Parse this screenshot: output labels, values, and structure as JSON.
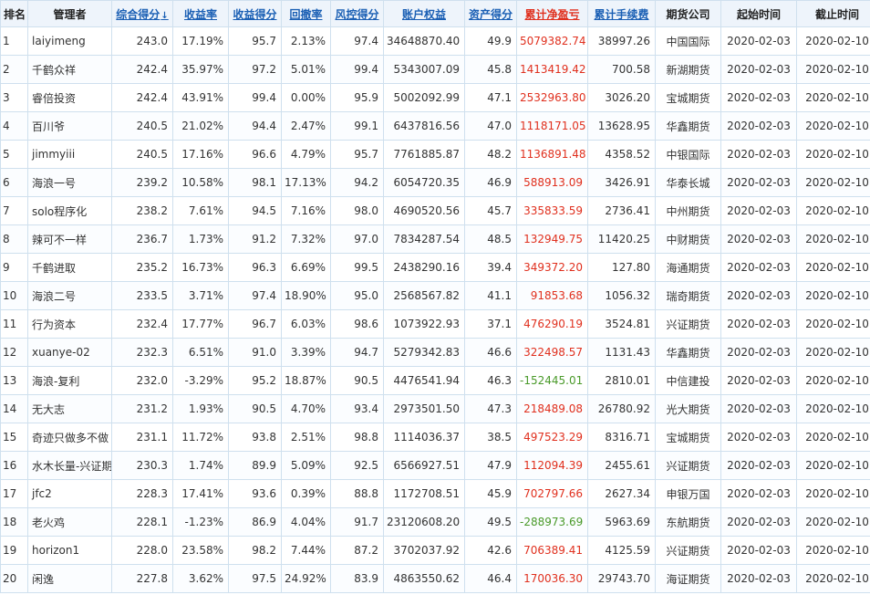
{
  "headers": [
    "排名",
    "管理者",
    "综合得分",
    "收益率",
    "收益得分",
    "回撤率",
    "风控得分",
    "账户权益",
    "资产得分",
    "累计净盈亏",
    "累计手续费",
    "期货公司",
    "起始时间",
    "截止时间"
  ],
  "sort_indicator": "↓",
  "colors": {
    "positive": "#e0301e",
    "negative": "#4a9a2a",
    "link": "#1a5fb4"
  },
  "rows": [
    {
      "rank": "1",
      "name": "laiyimeng",
      "score": "243.0",
      "ret": "17.19%",
      "ret_score": "95.7",
      "dd": "2.13%",
      "risk": "97.4",
      "equity": "34648870.40",
      "asset": "49.9",
      "pnl": "5079382.74",
      "fee": "38997.26",
      "company": "中国国际",
      "start": "2020-02-03",
      "end": "2020-02-10"
    },
    {
      "rank": "2",
      "name": "千鹤众祥",
      "score": "242.4",
      "ret": "35.97%",
      "ret_score": "97.2",
      "dd": "5.01%",
      "risk": "99.4",
      "equity": "5343007.09",
      "asset": "45.8",
      "pnl": "1413419.42",
      "fee": "700.58",
      "company": "新湖期货",
      "start": "2020-02-03",
      "end": "2020-02-10"
    },
    {
      "rank": "3",
      "name": "睿倍投资",
      "score": "242.4",
      "ret": "43.91%",
      "ret_score": "99.4",
      "dd": "0.00%",
      "risk": "95.9",
      "equity": "5002092.99",
      "asset": "47.1",
      "pnl": "2532963.80",
      "fee": "3026.20",
      "company": "宝城期货",
      "start": "2020-02-03",
      "end": "2020-02-10"
    },
    {
      "rank": "4",
      "name": "百川爷",
      "score": "240.5",
      "ret": "21.02%",
      "ret_score": "94.4",
      "dd": "2.47%",
      "risk": "99.1",
      "equity": "6437816.56",
      "asset": "47.0",
      "pnl": "1118171.05",
      "fee": "13628.95",
      "company": "华鑫期货",
      "start": "2020-02-03",
      "end": "2020-02-10"
    },
    {
      "rank": "5",
      "name": "jimmyiii",
      "score": "240.5",
      "ret": "17.16%",
      "ret_score": "96.6",
      "dd": "4.79%",
      "risk": "95.7",
      "equity": "7761885.87",
      "asset": "48.2",
      "pnl": "1136891.48",
      "fee": "4358.52",
      "company": "中银国际",
      "start": "2020-02-03",
      "end": "2020-02-10"
    },
    {
      "rank": "6",
      "name": "海浪一号",
      "score": "239.2",
      "ret": "10.58%",
      "ret_score": "98.1",
      "dd": "17.13%",
      "risk": "94.2",
      "equity": "6054720.35",
      "asset": "46.9",
      "pnl": "588913.09",
      "fee": "3426.91",
      "company": "华泰长城",
      "start": "2020-02-03",
      "end": "2020-02-10"
    },
    {
      "rank": "7",
      "name": "solo程序化",
      "score": "238.2",
      "ret": "7.61%",
      "ret_score": "94.5",
      "dd": "7.16%",
      "risk": "98.0",
      "equity": "4690520.56",
      "asset": "45.7",
      "pnl": "335833.59",
      "fee": "2736.41",
      "company": "中州期货",
      "start": "2020-02-03",
      "end": "2020-02-10"
    },
    {
      "rank": "8",
      "name": "辣可不一样",
      "score": "236.7",
      "ret": "1.73%",
      "ret_score": "91.2",
      "dd": "7.32%",
      "risk": "97.0",
      "equity": "7834287.54",
      "asset": "48.5",
      "pnl": "132949.75",
      "fee": "11420.25",
      "company": "中财期货",
      "start": "2020-02-03",
      "end": "2020-02-10"
    },
    {
      "rank": "9",
      "name": "千鹤进取",
      "score": "235.2",
      "ret": "16.73%",
      "ret_score": "96.3",
      "dd": "6.69%",
      "risk": "99.5",
      "equity": "2438290.16",
      "asset": "39.4",
      "pnl": "349372.20",
      "fee": "127.80",
      "company": "海通期货",
      "start": "2020-02-03",
      "end": "2020-02-10"
    },
    {
      "rank": "10",
      "name": "海浪二号",
      "score": "233.5",
      "ret": "3.71%",
      "ret_score": "97.4",
      "dd": "18.90%",
      "risk": "95.0",
      "equity": "2568567.82",
      "asset": "41.1",
      "pnl": "91853.68",
      "fee": "1056.32",
      "company": "瑞奇期货",
      "start": "2020-02-03",
      "end": "2020-02-10"
    },
    {
      "rank": "11",
      "name": "行为资本",
      "score": "232.4",
      "ret": "17.77%",
      "ret_score": "96.7",
      "dd": "6.03%",
      "risk": "98.6",
      "equity": "1073922.93",
      "asset": "37.1",
      "pnl": "476290.19",
      "fee": "3524.81",
      "company": "兴证期货",
      "start": "2020-02-03",
      "end": "2020-02-10"
    },
    {
      "rank": "12",
      "name": "xuanye-02",
      "score": "232.3",
      "ret": "6.51%",
      "ret_score": "91.0",
      "dd": "3.39%",
      "risk": "94.7",
      "equity": "5279342.83",
      "asset": "46.6",
      "pnl": "322498.57",
      "fee": "1131.43",
      "company": "华鑫期货",
      "start": "2020-02-03",
      "end": "2020-02-10"
    },
    {
      "rank": "13",
      "name": "海浪-复利",
      "score": "232.0",
      "ret": "-3.29%",
      "ret_score": "95.2",
      "dd": "18.87%",
      "risk": "90.5",
      "equity": "4476541.94",
      "asset": "46.3",
      "pnl": "-152445.01",
      "fee": "2810.01",
      "company": "中信建投",
      "start": "2020-02-03",
      "end": "2020-02-10"
    },
    {
      "rank": "14",
      "name": "无大志",
      "score": "231.2",
      "ret": "1.93%",
      "ret_score": "90.5",
      "dd": "4.70%",
      "risk": "93.4",
      "equity": "2973501.50",
      "asset": "47.3",
      "pnl": "218489.08",
      "fee": "26780.92",
      "company": "光大期货",
      "start": "2020-02-03",
      "end": "2020-02-10"
    },
    {
      "rank": "15",
      "name": "奇迹只做多不做",
      "score": "231.1",
      "ret": "11.72%",
      "ret_score": "93.8",
      "dd": "2.51%",
      "risk": "98.8",
      "equity": "1114036.37",
      "asset": "38.5",
      "pnl": "497523.29",
      "fee": "8316.71",
      "company": "宝城期货",
      "start": "2020-02-03",
      "end": "2020-02-10"
    },
    {
      "rank": "16",
      "name": "水木长量-兴证期",
      "score": "230.3",
      "ret": "1.74%",
      "ret_score": "89.9",
      "dd": "5.09%",
      "risk": "92.5",
      "equity": "6566927.51",
      "asset": "47.9",
      "pnl": "112094.39",
      "fee": "2455.61",
      "company": "兴证期货",
      "start": "2020-02-03",
      "end": "2020-02-10"
    },
    {
      "rank": "17",
      "name": "jfc2",
      "score": "228.3",
      "ret": "17.41%",
      "ret_score": "93.6",
      "dd": "0.39%",
      "risk": "88.8",
      "equity": "1172708.51",
      "asset": "45.9",
      "pnl": "702797.66",
      "fee": "2627.34",
      "company": "申银万国",
      "start": "2020-02-03",
      "end": "2020-02-10"
    },
    {
      "rank": "18",
      "name": "老火鸡",
      "score": "228.1",
      "ret": "-1.23%",
      "ret_score": "86.9",
      "dd": "4.04%",
      "risk": "91.7",
      "equity": "23120608.20",
      "asset": "49.5",
      "pnl": "-288973.69",
      "fee": "5963.69",
      "company": "东航期货",
      "start": "2020-02-03",
      "end": "2020-02-10"
    },
    {
      "rank": "19",
      "name": "horizon1",
      "score": "228.0",
      "ret": "23.58%",
      "ret_score": "98.2",
      "dd": "7.44%",
      "risk": "87.2",
      "equity": "3702037.92",
      "asset": "42.6",
      "pnl": "706389.41",
      "fee": "4125.59",
      "company": "兴证期货",
      "start": "2020-02-03",
      "end": "2020-02-10"
    },
    {
      "rank": "20",
      "name": "闲逸",
      "score": "227.8",
      "ret": "3.62%",
      "ret_score": "97.5",
      "dd": "24.92%",
      "risk": "83.9",
      "equity": "4863550.62",
      "asset": "46.4",
      "pnl": "170036.30",
      "fee": "29743.70",
      "company": "海证期货",
      "start": "2020-02-03",
      "end": "2020-02-10"
    }
  ]
}
